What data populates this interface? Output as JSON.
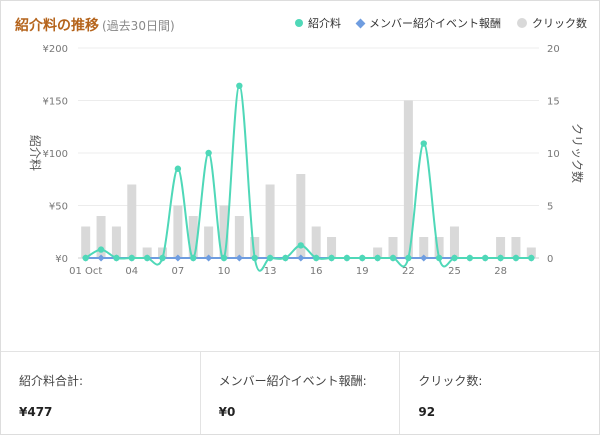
{
  "header": {
    "title": "紹介料の推移",
    "subtitle": "(過去30日間)"
  },
  "legend": [
    {
      "label": "紹介料",
      "color": "#4fd8b8",
      "shape": "circle"
    },
    {
      "label": "メンバー紹介イベント報酬",
      "color": "#6f9de0",
      "shape": "diamond"
    },
    {
      "label": "クリック数",
      "color": "#d9d9d9",
      "shape": "circle"
    }
  ],
  "chart_data": {
    "type": "bar+line",
    "x_labels": [
      "01 Oct",
      "02",
      "03",
      "04",
      "05",
      "06",
      "07",
      "08",
      "09",
      "10",
      "11",
      "12",
      "13",
      "14",
      "15",
      "16",
      "17",
      "18",
      "19",
      "20",
      "21",
      "22",
      "23",
      "24",
      "25",
      "26",
      "27",
      "28",
      "29",
      "30"
    ],
    "x_tick_labels": {
      "0": "01 Oct",
      "3": "04",
      "6": "07",
      "9": "10",
      "12": "13",
      "15": "16",
      "18": "19",
      "21": "22",
      "24": "25",
      "27": "28"
    },
    "left_axis": {
      "label": "紹介料",
      "ticks": [
        "¥0",
        "¥50",
        "¥100",
        "¥150",
        "¥200"
      ],
      "range": [
        0,
        200
      ]
    },
    "right_axis": {
      "label": "クリック数",
      "ticks": [
        "0",
        "5",
        "10",
        "15",
        "20"
      ],
      "range": [
        0,
        20
      ]
    },
    "series": [
      {
        "name": "クリック数",
        "type": "bar",
        "axis": "right",
        "color": "#d9d9d9",
        "values": [
          3,
          4,
          3,
          7,
          1,
          1,
          5,
          4,
          3,
          5,
          4,
          2,
          7,
          0,
          8,
          3,
          2,
          0,
          0,
          1,
          2,
          15,
          2,
          2,
          3,
          0,
          0,
          2,
          2,
          1
        ]
      },
      {
        "name": "紹介料",
        "type": "line",
        "axis": "left",
        "color": "#4fd8b8",
        "values": [
          0,
          8,
          0,
          0,
          0,
          0,
          85,
          0,
          100,
          0,
          164,
          0,
          0,
          0,
          12,
          0,
          0,
          0,
          0,
          0,
          0,
          0,
          109,
          0,
          0,
          0,
          0,
          0,
          0,
          0
        ]
      },
      {
        "name": "メンバー紹介イベント報酬",
        "type": "line",
        "axis": "left",
        "color": "#6f9de0",
        "values": [
          0,
          0,
          0,
          0,
          0,
          0,
          0,
          0,
          0,
          0,
          0,
          0,
          0,
          0,
          0,
          0,
          0,
          0,
          0,
          0,
          0,
          0,
          0,
          0,
          0,
          0,
          0,
          0,
          0,
          0
        ]
      }
    ],
    "grid": true
  },
  "summary": [
    {
      "label": "紹介料合計:",
      "value": "¥477"
    },
    {
      "label": "メンバー紹介イベント報酬:",
      "value": "¥0"
    },
    {
      "label": "クリック数:",
      "value": "92"
    }
  ]
}
